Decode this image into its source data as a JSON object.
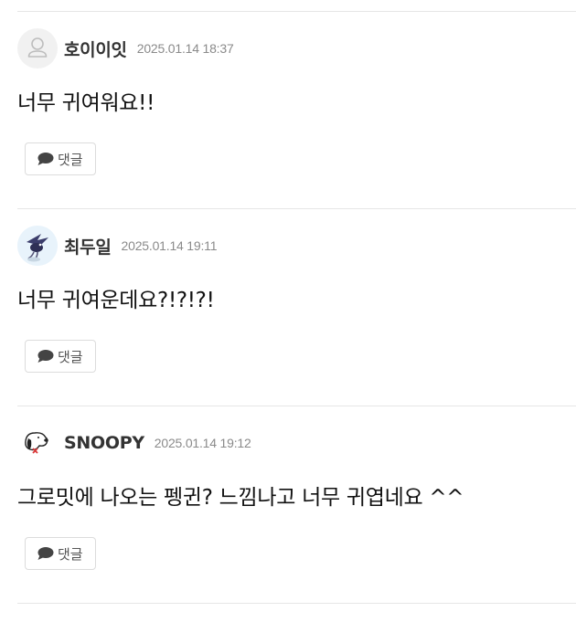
{
  "comments": [
    {
      "nickname": "호이이잇",
      "timestamp": "2025.01.14 18:37",
      "text": "너무 귀여워요!!",
      "avatar": "default-user-icon",
      "reply_label": "댓글"
    },
    {
      "nickname": "최두일",
      "timestamp": "2025.01.14 19:11",
      "text": "너무 귀여운데요?!?!?!",
      "avatar": "bird-avatar",
      "reply_label": "댓글"
    },
    {
      "nickname": "SNOOPY",
      "timestamp": "2025.01.14 19:12",
      "text": "그로밋에 나오는 펭귄? 느낌나고 너무 귀엽네요 ^^",
      "avatar": "snoopy-avatar",
      "reply_label": "댓글"
    }
  ],
  "icons": {
    "reply": "speech-bubble-icon"
  },
  "colors": {
    "divider": "#e6e6e6",
    "timestamp": "#8a8a8a",
    "button_border": "#dcdcdc"
  }
}
